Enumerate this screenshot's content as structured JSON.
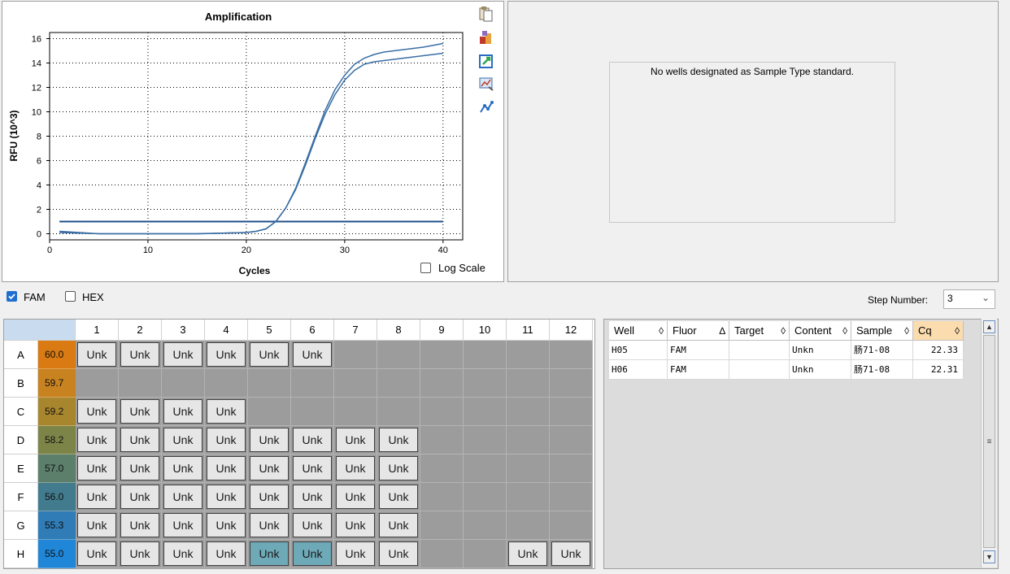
{
  "chart_data": {
    "type": "line",
    "title": "Amplification",
    "xlabel": "Cycles",
    "ylabel": "RFU (10^3)",
    "xlim": [
      0,
      42
    ],
    "ylim": [
      -0.5,
      16.5
    ],
    "xticks": [
      0,
      10,
      20,
      30,
      40
    ],
    "yticks": [
      0,
      2,
      4,
      6,
      8,
      10,
      12,
      14,
      16
    ],
    "grid": true,
    "threshold": 1.0,
    "series": [
      {
        "x": [
          1,
          5,
          10,
          15,
          20,
          21,
          22,
          23,
          24,
          25,
          26,
          27,
          28,
          29,
          30,
          31,
          32,
          33,
          34,
          35,
          36,
          37,
          38,
          39,
          40
        ],
        "y": [
          0.1,
          0.0,
          0.0,
          0.0,
          0.1,
          0.2,
          0.4,
          1.0,
          2.1,
          3.7,
          5.8,
          8.0,
          10.1,
          11.8,
          13.0,
          13.9,
          14.4,
          14.7,
          14.9,
          15.0,
          15.1,
          15.2,
          15.3,
          15.45,
          15.6
        ]
      },
      {
        "x": [
          1,
          5,
          10,
          15,
          20,
          21,
          22,
          23,
          24,
          25,
          26,
          27,
          28,
          29,
          30,
          31,
          32,
          33,
          34,
          35,
          36,
          37,
          38,
          39,
          40
        ],
        "y": [
          0.2,
          0.0,
          0.0,
          0.0,
          0.1,
          0.2,
          0.4,
          1.0,
          2.1,
          3.6,
          5.6,
          7.8,
          9.8,
          11.4,
          12.6,
          13.4,
          13.9,
          14.1,
          14.2,
          14.3,
          14.4,
          14.5,
          14.6,
          14.7,
          14.8
        ]
      }
    ],
    "colors": {
      "line": "#3a6ea5",
      "threshold": "#1f4f8a"
    }
  },
  "chart_panel": {
    "log_scale_label": "Log Scale",
    "log_scale_checked": false
  },
  "toolbar_icons": [
    "copy-icon",
    "export-icon",
    "chart-icon",
    "zoom-chart-icon",
    "line-style-icon"
  ],
  "standard_curve": {
    "message": "No wells designated as Sample Type standard."
  },
  "filters": {
    "fam_label": "FAM",
    "fam_checked": true,
    "hex_label": "HEX",
    "hex_checked": false,
    "step_label": "Step Number:",
    "step_value": "3"
  },
  "plate": {
    "columns": [
      "1",
      "2",
      "3",
      "4",
      "5",
      "6",
      "7",
      "8",
      "9",
      "10",
      "11",
      "12"
    ],
    "rows": [
      {
        "label": "A",
        "temp": "60.0",
        "color": "#d97b12",
        "wells": [
          "Unk",
          "Unk",
          "Unk",
          "Unk",
          "Unk",
          "Unk",
          "",
          "",
          "",
          "",
          "",
          ""
        ]
      },
      {
        "label": "B",
        "temp": "59.7",
        "color": "#c88220",
        "wells": [
          "",
          "",
          "",
          "",
          "",
          "",
          "",
          "",
          "",
          "",
          "",
          ""
        ]
      },
      {
        "label": "C",
        "temp": "59.2",
        "color": "#a8862e",
        "wells": [
          "Unk",
          "Unk",
          "Unk",
          "Unk",
          "",
          "",
          "",
          "",
          "",
          "",
          "",
          ""
        ]
      },
      {
        "label": "D",
        "temp": "58.2",
        "color": "#7c8448",
        "wells": [
          "Unk",
          "Unk",
          "Unk",
          "Unk",
          "Unk",
          "Unk",
          "Unk",
          "Unk",
          "",
          "",
          "",
          ""
        ]
      },
      {
        "label": "E",
        "temp": "57.0",
        "color": "#5b7f6a",
        "wells": [
          "Unk",
          "Unk",
          "Unk",
          "Unk",
          "Unk",
          "Unk",
          "Unk",
          "Unk",
          "",
          "",
          "",
          ""
        ]
      },
      {
        "label": "F",
        "temp": "56.0",
        "color": "#427b8e",
        "wells": [
          "Unk",
          "Unk",
          "Unk",
          "Unk",
          "Unk",
          "Unk",
          "Unk",
          "Unk",
          "",
          "",
          "",
          ""
        ]
      },
      {
        "label": "G",
        "temp": "55.3",
        "color": "#2f7cb6",
        "wells": [
          "Unk",
          "Unk",
          "Unk",
          "Unk",
          "Unk",
          "Unk",
          "Unk",
          "Unk",
          "",
          "",
          "",
          ""
        ]
      },
      {
        "label": "H",
        "temp": "55.0",
        "color": "#1f86d8",
        "wells": [
          "Unk",
          "Unk",
          "Unk",
          "Unk",
          "Unk",
          "Unk",
          "Unk",
          "Unk",
          "",
          "",
          "Unk",
          "Unk"
        ],
        "selected": [
          4,
          5
        ]
      }
    ]
  },
  "results_table": {
    "columns": [
      {
        "label": "Well",
        "sort": "◊"
      },
      {
        "label": "Fluor",
        "sort": "∆"
      },
      {
        "label": "Target",
        "sort": "◊"
      },
      {
        "label": "Content",
        "sort": "◊"
      },
      {
        "label": "Sample",
        "sort": "◊"
      },
      {
        "label": "Cq",
        "sort": "◊"
      }
    ],
    "rows": [
      [
        "H05",
        "FAM",
        "",
        "Unkn",
        "肠71-08",
        "22.33"
      ],
      [
        "H06",
        "FAM",
        "",
        "Unkn",
        "肠71-08",
        "22.31"
      ]
    ]
  }
}
